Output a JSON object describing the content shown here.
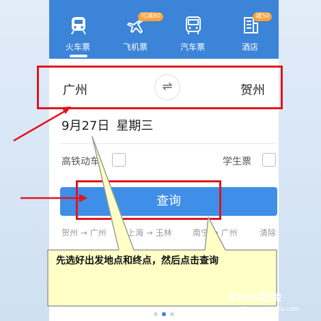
{
  "tabs": [
    {
      "label": "火车票",
      "icon": "train-icon",
      "badge": ""
    },
    {
      "label": "飞机票",
      "icon": "plane-icon",
      "badge": "可减80"
    },
    {
      "label": "汽车票",
      "icon": "bus-icon",
      "badge": ""
    },
    {
      "label": "酒店",
      "icon": "hotel-icon",
      "badge": "减50"
    }
  ],
  "form": {
    "from_city": "广州",
    "to_city": "贺州",
    "swap_symbol": "⇌",
    "date": "9月27日",
    "weekday": "星期三",
    "option_highspeed": "高铁动车",
    "option_student": "学生票",
    "search_label": "查询"
  },
  "history": [
    "贺州 → 广州",
    "上海 → 玉林",
    "南宁 → 广州",
    "清除"
  ],
  "annotation": {
    "text": "先选好出发地点和终点，然后点击查询"
  },
  "watermark": {
    "brand": "Baidu经验",
    "url": "jingyan.baidu.com"
  },
  "colors": {
    "header": "#3b84d8",
    "button": "#3f8ee8",
    "annotation_red": "#e0141e",
    "callout_fill": "#ffffc6",
    "badge": "#f7a23b"
  }
}
